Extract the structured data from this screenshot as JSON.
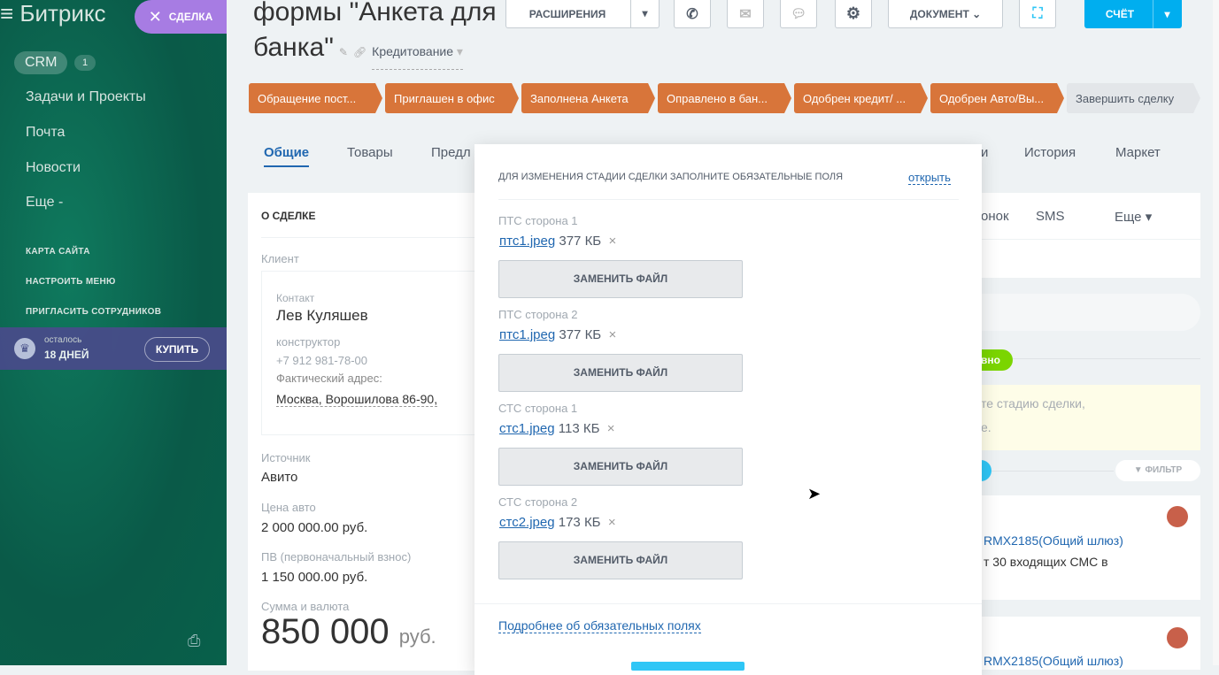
{
  "sidebar": {
    "logo": "Битрикс",
    "close_deal": "СДЕЛКА",
    "crm": "CRM",
    "crm_count": "1",
    "items": [
      "Задачи и Проекты",
      "Почта",
      "Новости",
      "Еще -"
    ],
    "small_items": [
      "КАРТА САЙТА",
      "НАСТРОИТЬ МЕНЮ",
      "ПРИГЛАСИТЬ СОТРУДНИКОВ"
    ],
    "trial_line1": "осталось",
    "trial_line2": "18 ДНЕЙ",
    "buy": "КУПИТЬ"
  },
  "header": {
    "title_line1": "формы \"Анкета для",
    "title_line2": "банка\"",
    "category": "Кредитование",
    "extensions": "РАСШИРЕНИЯ",
    "document": "ДОКУМЕНТ",
    "invoice": "СЧЁТ"
  },
  "stages": [
    "Обращение пост...",
    "Приглашен в офис",
    "Заполнена Анкета",
    "Оправлено в бан...",
    "Одобрен кредит/ ...",
    "Одобрен Авто/Вы...",
    "Завершить сделку"
  ],
  "tabs": [
    "Общие",
    "Товары",
    "Предл",
    "и",
    "История",
    "Маркет"
  ],
  "deal": {
    "section": "О СДЕЛКЕ",
    "client_label": "Клиент",
    "contact_label": "Контакт",
    "contact_name": "Лев Куляшев",
    "position": "конструктор",
    "phone": "+7 912 981-78-00",
    "address_label": "Фактический адрес:",
    "address": "Москва, Ворошилова 86-90,",
    "source_label": "Источник",
    "source": "Авито",
    "price_label": "Цена авто",
    "price": "2 000 000.00 руб.",
    "down_label": "ПВ (первоначальный взнос)",
    "down": "1 150 000.00 руб.",
    "sum_label": "Сумма и валюта",
    "sum": "850 000",
    "currency": "руб."
  },
  "timeline": {
    "tabs": [
      "онок",
      "SMS",
      "Еще"
    ],
    "badge": "вно",
    "notice1": "те стадию сделки,",
    "notice2": "е.",
    "filter": "ФИЛЬТР",
    "item1_link": "RMX2185(Общий шлюз)",
    "item1_text": "т 30 входящих СМС в",
    "item2_link": "RMX2185(Общий шлюз)"
  },
  "modal": {
    "title": "ДЛЯ ИЗМЕНЕНИЯ СТАДИИ СДЕЛКИ ЗАПОЛНИТЕ ОБЯЗАТЕЛЬНЫЕ ПОЛЯ",
    "open": "открыть",
    "fields": [
      {
        "label": "ПТС сторона 1",
        "file": "птс1.jpeg",
        "size": "377 КБ"
      },
      {
        "label": "ПТС сторона 2",
        "file": "птс1.jpeg",
        "size": "377 КБ"
      },
      {
        "label": "СТС сторона 1",
        "file": "стс1.jpeg",
        "size": "113 КБ"
      },
      {
        "label": "СТС сторона 2",
        "file": "стс2.jpeg",
        "size": "173 КБ"
      }
    ],
    "replace": "ЗАМЕНИТЬ ФАЙЛ",
    "more": "Подробнее об обязательных полях"
  }
}
